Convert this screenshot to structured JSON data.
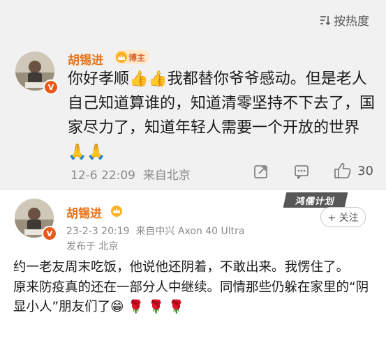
{
  "sort": {
    "label": "按热度"
  },
  "comment": {
    "username": "胡锡进",
    "op_badge": "博主",
    "text": "你好孝顺👍👍我都替你爷爷感动。但是老人自己知道算谁的，知道清零坚持不下去了，国家尽力了，知道年轻人需要一个开放的世界🙏🙏",
    "date": "12-6 22:09",
    "source": "来自北京",
    "like_count": "30"
  },
  "post": {
    "username": "胡锡进",
    "watermark": "鸿儒计划",
    "follow_label": "+ 关注",
    "time": "23-2-3 20:19",
    "device": "来自中兴 Axon 40 Ultra",
    "location": "发布于 北京",
    "text_main": "约一老友周末吃饭，他说他还阴着，不敢出来。我愣住了。\n原来防疫真的还在一部分人中继续。同情那些仍躲在家里的“阴显小人”朋友们了😁",
    "roses": "🌹 🌹 🌹"
  },
  "colors": {
    "username": "#e8731a",
    "verified": "#e8591a",
    "op_badge_bg": "#ffe8c7"
  }
}
